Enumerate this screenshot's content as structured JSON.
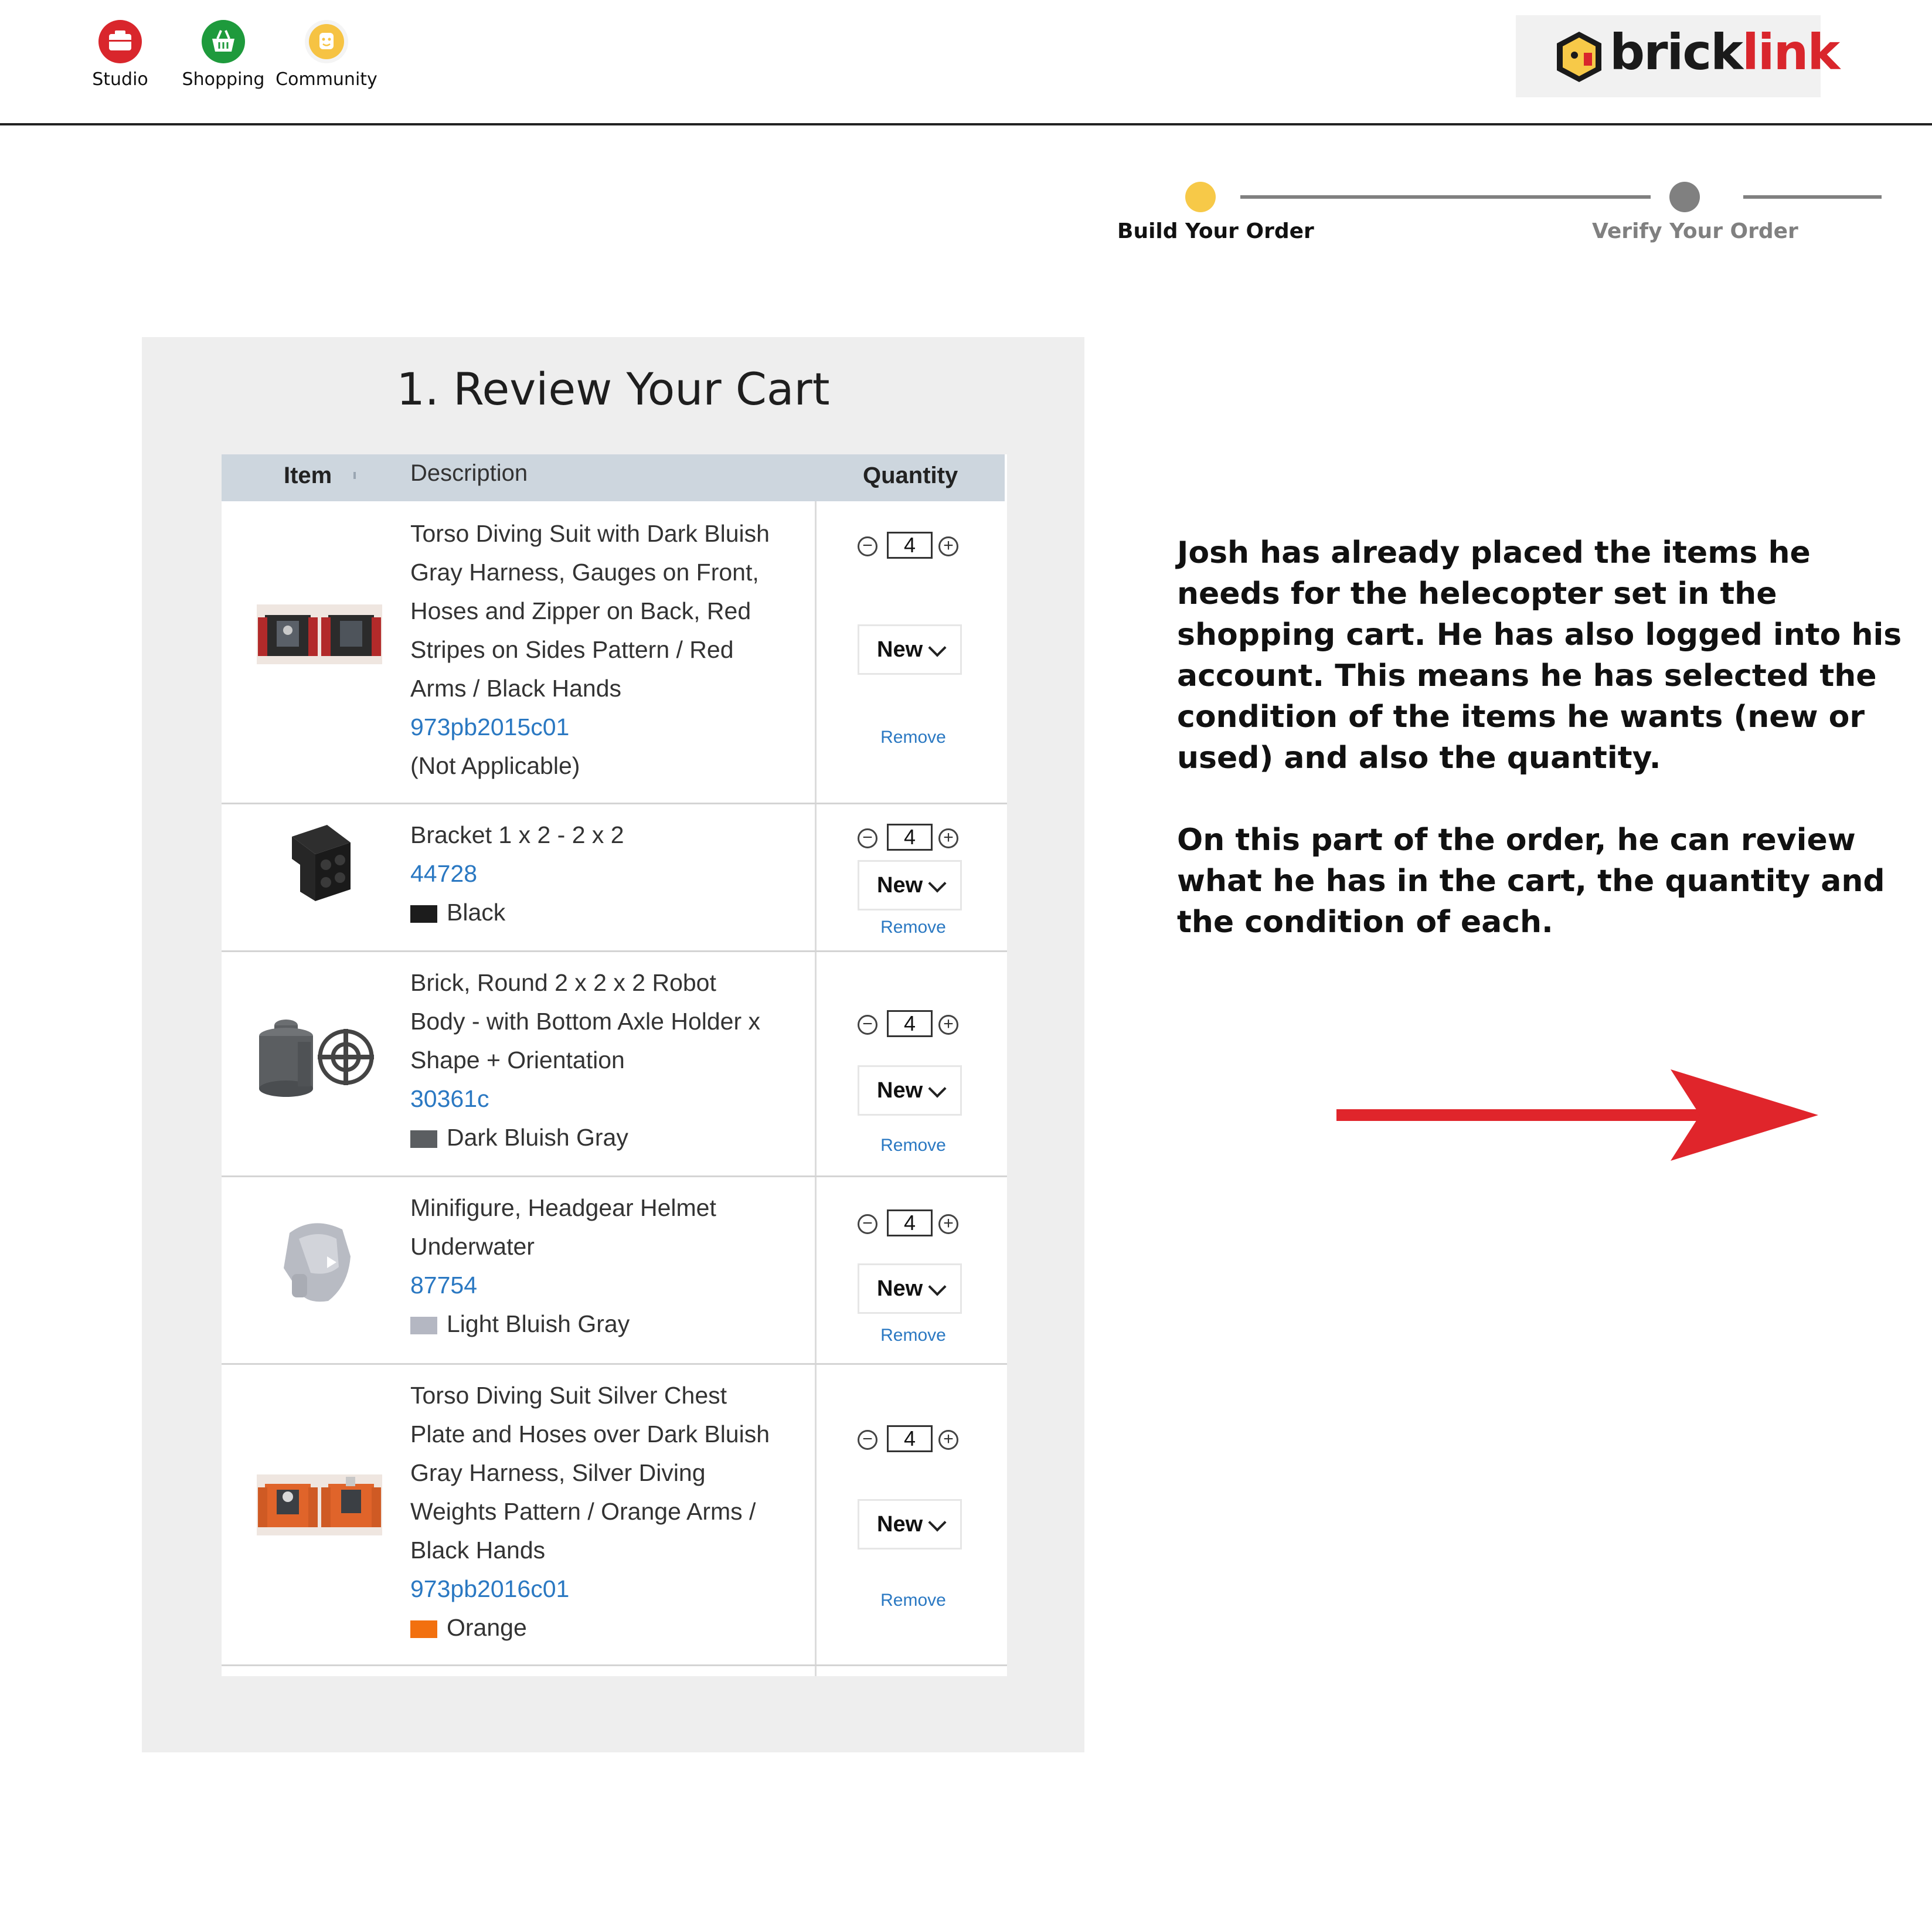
{
  "nav": {
    "items": [
      {
        "label": "Studio",
        "icon": "studio-icon",
        "color": "#d9262c"
      },
      {
        "label": "Shopping",
        "icon": "shopping-basket-icon",
        "color": "#1e9a3c"
      },
      {
        "label": "Community",
        "icon": "minifig-head-icon",
        "color": "#f6c343"
      }
    ],
    "logo": {
      "part1": "brick",
      "part2": "link"
    }
  },
  "progress": {
    "steps": [
      {
        "label": "Build Your Order",
        "state": "active",
        "color": "#f7c948"
      },
      {
        "label": "Verify Your Order",
        "state": "pending",
        "color": "#808080"
      }
    ]
  },
  "cart": {
    "title": "1. Review Your Cart",
    "columns": {
      "item": "Item",
      "description": "Description",
      "quantity": "Quantity"
    },
    "remove_label": "Remove",
    "items": [
      {
        "lines": [
          "Torso Diving Suit with Dark Bluish",
          "Gray Harness, Gauges on Front,",
          "Hoses and Zipper on Back, Red",
          "Stripes on Sides Pattern / Red",
          "Arms / Black Hands"
        ],
        "code": "973pb2015c01",
        "color_name": "(Not Applicable)",
        "swatch": null,
        "qty": "4",
        "condition": "New",
        "thumb": "red-torso"
      },
      {
        "lines": [
          "Bracket 1 x 2 - 2 x 2"
        ],
        "code": "44728",
        "color_name": "Black",
        "swatch": "#1c1c1c",
        "qty": "4",
        "condition": "New",
        "thumb": "black-bracket"
      },
      {
        "lines": [
          "Brick, Round 2 x 2 x 2 Robot",
          "Body - with Bottom Axle Holder x",
          "Shape + Orientation"
        ],
        "code": "30361c",
        "color_name": "Dark Bluish Gray",
        "swatch": "#5b5e61",
        "qty": "4",
        "condition": "New",
        "thumb": "gray-round-brick"
      },
      {
        "lines": [
          "Minifigure, Headgear Helmet",
          "Underwater"
        ],
        "code": "87754",
        "color_name": "Light Bluish Gray",
        "swatch": "#b4b7c2",
        "qty": "4",
        "condition": "New",
        "thumb": "gray-helmet"
      },
      {
        "lines": [
          "Torso Diving Suit Silver Chest",
          "Plate and Hoses over Dark Bluish",
          "Gray Harness, Silver Diving",
          "Weights Pattern / Orange Arms /",
          "Black Hands"
        ],
        "code": "973pb2016c01",
        "color_name": "Orange",
        "swatch": "#f2700f",
        "qty": "4",
        "condition": "New",
        "thumb": "orange-torso"
      }
    ]
  },
  "annotation": {
    "paragraph1": "Josh has already placed the items he needs for the helecopter set in the shopping cart. He has also logged into his account. This means he has selected the condition of the items he wants (new or used) and also the quantity.",
    "paragraph2": "On this part of the order, he can review what he has in the cart, the quantity and the condition of each.",
    "arrow_color": "#e0252b"
  }
}
